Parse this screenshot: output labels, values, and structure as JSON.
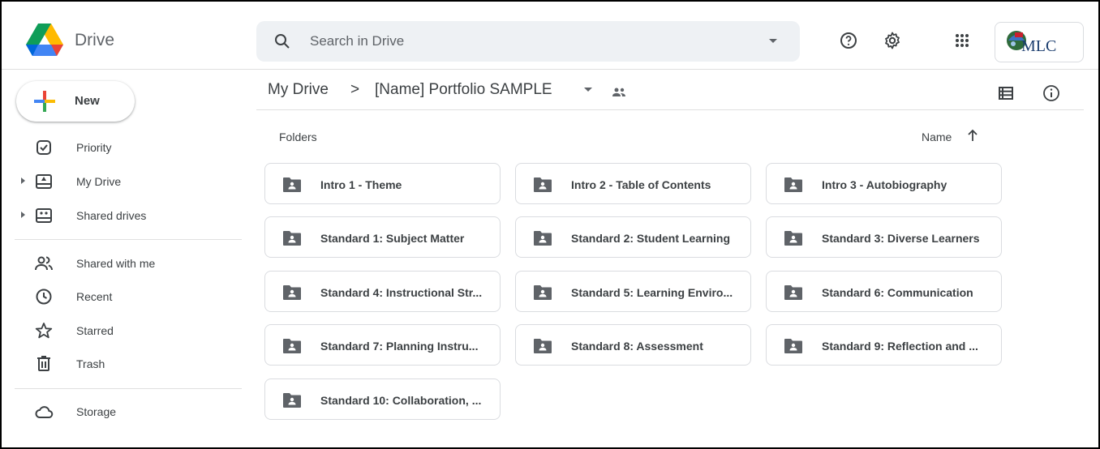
{
  "app": {
    "name": "Drive"
  },
  "search": {
    "placeholder": "Search in Drive"
  },
  "account": {
    "label": "MLC"
  },
  "sidebar": {
    "new_label": "New",
    "items": [
      {
        "label": "Priority",
        "icon": "priority-icon"
      },
      {
        "label": "My Drive",
        "icon": "my-drive-icon"
      },
      {
        "label": "Shared drives",
        "icon": "shared-drives-icon"
      },
      {
        "label": "Shared with me",
        "icon": "shared-with-me-icon"
      },
      {
        "label": "Recent",
        "icon": "clock-icon"
      },
      {
        "label": "Starred",
        "icon": "star-icon"
      },
      {
        "label": "Trash",
        "icon": "trash-icon"
      },
      {
        "label": "Storage",
        "icon": "cloud-icon"
      }
    ]
  },
  "breadcrumb": {
    "root": "My Drive",
    "separator": ">",
    "current": "[Name] Portfolio SAMPLE"
  },
  "main": {
    "section_label": "Folders",
    "sort_label": "Name",
    "folders": [
      "Intro 1 - Theme",
      "Intro 2 - Table of Contents",
      "Intro 3 - Autobiography",
      "Standard 1: Subject Matter",
      "Standard 2: Student Learning",
      "Standard 3: Diverse Learners",
      "Standard 4: Instructional Str...",
      "Standard 5: Learning Enviro...",
      "Standard 6: Communication",
      "Standard 7: Planning Instru...",
      "Standard 8: Assessment",
      "Standard 9: Reflection and ...",
      "Standard 10: Collaboration, ..."
    ]
  },
  "colors": {
    "accent": "#1a73e8",
    "text": "#3c4043",
    "search_bg": "#eef1f4",
    "icon": "#5f6368"
  }
}
